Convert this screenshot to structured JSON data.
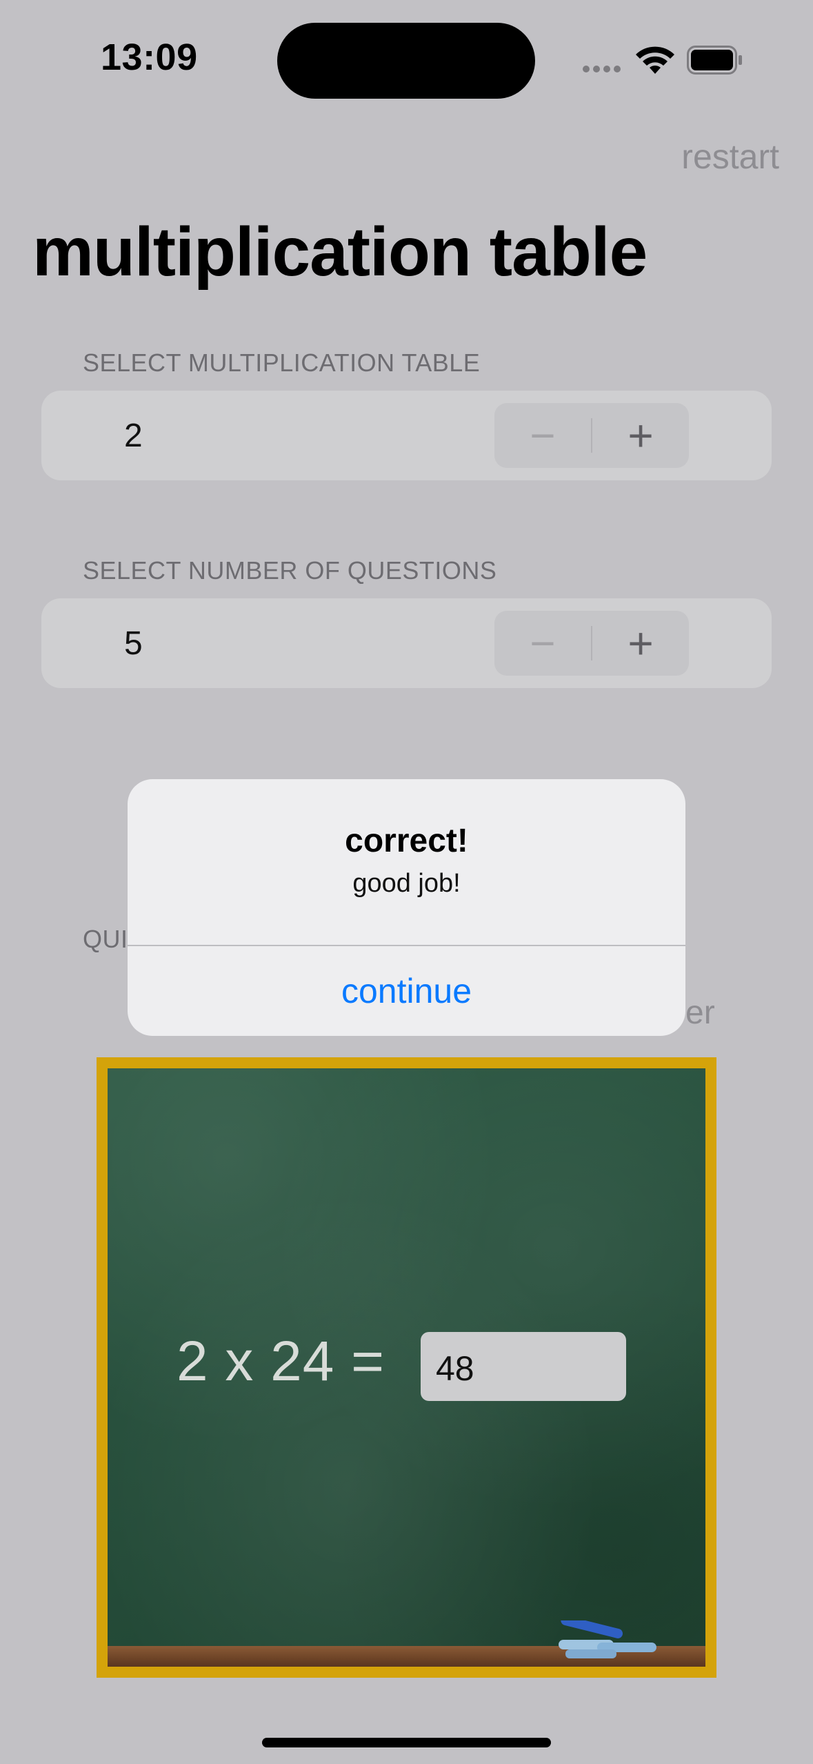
{
  "status_bar": {
    "time": "13:09"
  },
  "nav": {
    "restart_label": "restart"
  },
  "page_title": "multiplication table",
  "table_section": {
    "label": "SELECT MULTIPLICATION TABLE",
    "value": "2",
    "minus": "−",
    "plus": "+"
  },
  "questions_section": {
    "label": "SELECT NUMBER OF QUESTIONS",
    "value": "5",
    "minus": "−",
    "plus": "+"
  },
  "partial_labels": {
    "question_fragment": "QUI",
    "answer_fragment": "ver"
  },
  "alert": {
    "title": "correct!",
    "message": "good job!",
    "button": "continue"
  },
  "board": {
    "equation": "2 x 24 =",
    "answer_value": "48"
  },
  "colors": {
    "accent": "#0a7aff",
    "frame": "#d4a30a",
    "board": "#274f3c",
    "dim_background": "#c2c1c5"
  },
  "icons": [
    "cellular-signal-icon",
    "wifi-icon",
    "battery-icon",
    "chalk-icon"
  ]
}
